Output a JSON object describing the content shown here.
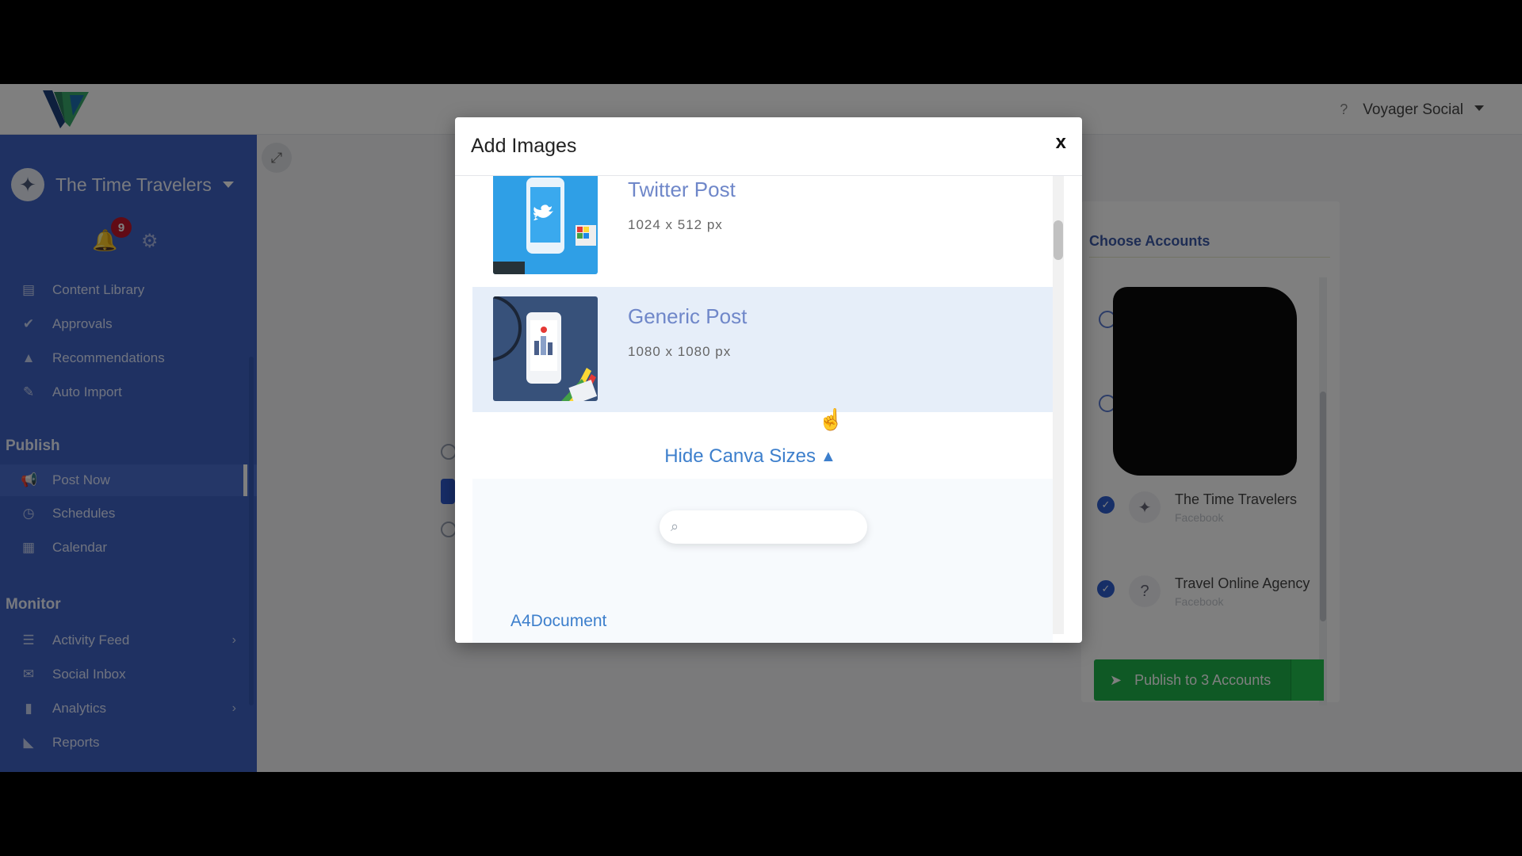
{
  "app": {
    "brand_icon": "voyager-logo-icon",
    "user_name": "Voyager Social"
  },
  "sidebar": {
    "account_name": "The Time Travelers",
    "notification_count": "9",
    "library_items": [
      {
        "label": "Content Library",
        "icon": "file-icon"
      },
      {
        "label": "Approvals",
        "icon": "check-circle-icon"
      },
      {
        "label": "Recommendations",
        "icon": "flask-icon"
      },
      {
        "label": "Auto Import",
        "icon": "magic-wand-icon"
      }
    ],
    "publish_heading": "Publish",
    "publish_items": [
      {
        "label": "Post Now",
        "icon": "bullhorn-icon",
        "active": true
      },
      {
        "label": "Schedules",
        "icon": "clock-icon"
      },
      {
        "label": "Calendar",
        "icon": "calendar-icon"
      }
    ],
    "monitor_heading": "Monitor",
    "monitor_items": [
      {
        "label": "Activity Feed",
        "icon": "list-icon",
        "has_submenu": true
      },
      {
        "label": "Social Inbox",
        "icon": "envelope-icon"
      },
      {
        "label": "Analytics",
        "icon": "bar-chart-icon",
        "has_submenu": true
      },
      {
        "label": "Reports",
        "icon": "area-chart-icon"
      }
    ]
  },
  "accounts_panel": {
    "title": "Choose Accounts",
    "accounts": [
      {
        "name": "The Time Travelers",
        "sub": "Facebook",
        "checked": true
      },
      {
        "name": "Travel Online Agency",
        "sub": "Facebook",
        "checked": true
      }
    ],
    "publish_label": "Publish to 3 Accounts"
  },
  "modal": {
    "title": "Add Images",
    "close_label": "x",
    "sizes": [
      {
        "name": "Twitter Post",
        "dims": "1024 x 512 px"
      },
      {
        "name": "Generic Post",
        "dims": "1080 x 1080 px"
      }
    ],
    "hide_sizes_label": "Hide Canva Sizes",
    "search_placeholder": "",
    "canva_items": [
      {
        "label": "A4Document"
      }
    ]
  }
}
